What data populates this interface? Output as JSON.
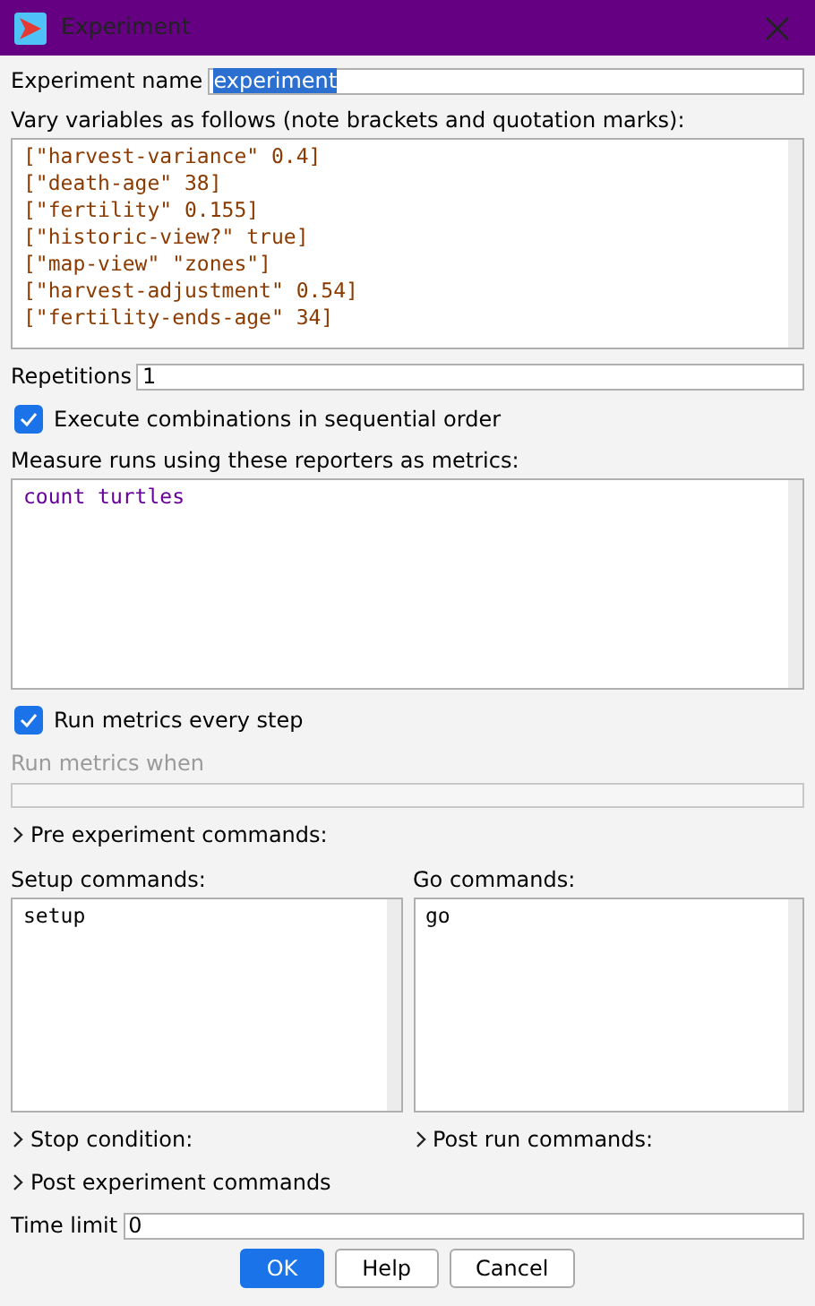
{
  "window": {
    "title": "Experiment"
  },
  "experiment_name": {
    "label": "Experiment name",
    "value": "experiment",
    "selected": true
  },
  "vary_variables": {
    "label": "Vary variables as follows (note brackets and quotation marks):",
    "lines": [
      "[\"harvest-variance\" 0.4]",
      "[\"death-age\" 38]",
      "[\"fertility\" 0.155]",
      "[\"historic-view?\" true]",
      "[\"map-view\" \"zones\"]",
      "[\"harvest-adjustment\" 0.54]",
      "[\"fertility-ends-age\" 34]"
    ]
  },
  "repetitions": {
    "label": "Repetitions",
    "value": "1"
  },
  "sequential_order": {
    "label": "Execute combinations in sequential order",
    "checked": true
  },
  "metrics": {
    "label": "Measure runs using these reporters as metrics:",
    "lines": [
      "count turtles"
    ]
  },
  "run_every_step": {
    "label": "Run metrics every step",
    "checked": true
  },
  "run_metrics_when": {
    "label": "Run metrics when",
    "disabled": true
  },
  "pre_experiment": {
    "label": "Pre experiment commands:",
    "expanded": false
  },
  "setup_commands": {
    "label": "Setup commands:",
    "lines": [
      "setup"
    ]
  },
  "go_commands": {
    "label": "Go commands:",
    "lines": [
      "go"
    ]
  },
  "stop_condition": {
    "label": "Stop condition:",
    "expanded": false
  },
  "post_run": {
    "label": "Post run commands:",
    "expanded": false
  },
  "post_experiment": {
    "label": "Post experiment commands",
    "expanded": false
  },
  "time_limit": {
    "label": "Time limit",
    "value": "0"
  },
  "buttons": [
    {
      "label": "OK",
      "kind": "primary"
    },
    {
      "label": "Help",
      "kind": "secondary"
    },
    {
      "label": "Cancel",
      "kind": "secondary"
    }
  ]
}
